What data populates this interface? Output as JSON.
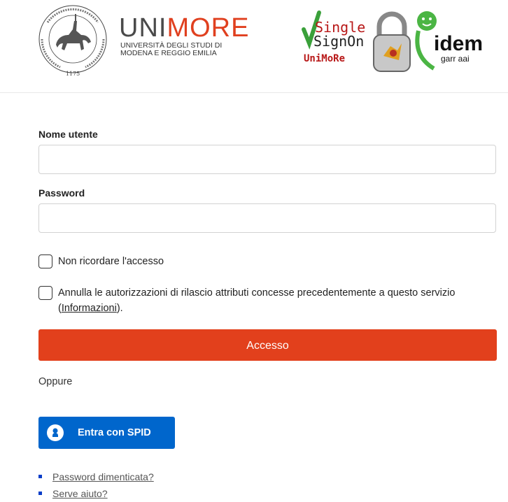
{
  "header": {
    "seal_year": "1175",
    "brand_part1": "UNI",
    "brand_part2": "MORE",
    "subtitle_line1": "Università degli studi di",
    "subtitle_line2": "Modena e Reggio Emilia",
    "sso": {
      "word1": "Single",
      "word2": "SignOn",
      "word3": "UniMoRe",
      "idem": "idem",
      "garr": "garr aai"
    }
  },
  "form": {
    "username_label": "Nome utente",
    "username_value": "",
    "password_label": "Password",
    "password_value": "",
    "checkbox_dont_remember": "Non ricordare l'accesso",
    "checkbox_revoke_text": "Annulla le autorizzazioni di rilascio attributi concesse precedentemente a questo servizio",
    "checkbox_revoke_link_open": "(",
    "checkbox_revoke_link": "Informazioni",
    "checkbox_revoke_link_close": ").",
    "submit_label": "Accesso",
    "or_label": "Oppure",
    "spid_label": "Entra con SPID"
  },
  "links": [
    {
      "label": "Password dimenticata?"
    },
    {
      "label": "Serve aiuto?"
    }
  ],
  "colors": {
    "accent": "#e2401c",
    "spid_blue": "#0066cc",
    "bullet": "#0a3ec8"
  }
}
